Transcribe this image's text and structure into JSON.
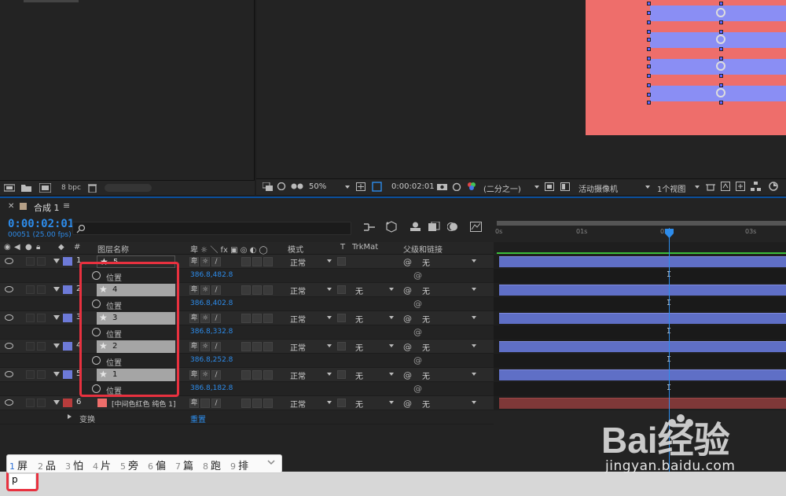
{
  "viewer_toolbar": {
    "bpc_label": "8 bpc",
    "zoom": "50%",
    "timecode": "0:00:02:01",
    "resolution": "(二分之一)",
    "camera": "活动摄像机",
    "views": "1个视图"
  },
  "timeline": {
    "tab_title": "合成 1",
    "current_time": "0:00:02:01",
    "frame_info": "00051 (25.00 fps)",
    "search_placeholder": "",
    "headers": {
      "number": "#",
      "layer_name": "图层名称",
      "mode": "模式",
      "t": "T",
      "trkmat": "TrkMat",
      "parent": "父级和链接"
    },
    "ruler_ticks": [
      "0s",
      "01s",
      "02s",
      "03s"
    ],
    "layers": [
      {
        "num": "1",
        "name": "5",
        "mode": "正常",
        "trkmat": "",
        "parent": "无",
        "prop_label": "位置",
        "prop_value": "386.8,482.8"
      },
      {
        "num": "2",
        "name": "4",
        "mode": "正常",
        "trkmat": "无",
        "parent": "无",
        "prop_label": "位置",
        "prop_value": "386.8,402.8"
      },
      {
        "num": "3",
        "name": "3",
        "mode": "正常",
        "trkmat": "无",
        "parent": "无",
        "prop_label": "位置",
        "prop_value": "386.8,332.8"
      },
      {
        "num": "4",
        "name": "2",
        "mode": "正常",
        "trkmat": "无",
        "parent": "无",
        "prop_label": "位置",
        "prop_value": "386.8,252.8"
      },
      {
        "num": "5",
        "name": "1",
        "mode": "正常",
        "trkmat": "无",
        "parent": "无",
        "prop_label": "位置",
        "prop_value": "386.8,182.8"
      }
    ],
    "solid_layer": {
      "num": "6",
      "name": "[中间色红色 纯色 1]",
      "mode": "正常",
      "trkmat": "无",
      "parent": "无"
    },
    "transform": {
      "label": "变换",
      "reset": "重置"
    }
  },
  "ime": {
    "candidates": [
      {
        "num": "1",
        "char": "屏"
      },
      {
        "num": "2",
        "char": "品"
      },
      {
        "num": "3",
        "char": "怕"
      },
      {
        "num": "4",
        "char": "片"
      },
      {
        "num": "5",
        "char": "旁"
      },
      {
        "num": "6",
        "char": "偏"
      },
      {
        "num": "7",
        "char": "篇"
      },
      {
        "num": "8",
        "char": "跑"
      },
      {
        "num": "9",
        "char": "排"
      }
    ],
    "input_text": "p"
  },
  "watermark": {
    "brand": "Bai经验",
    "url": "jingyan.baidu.com"
  },
  "colors": {
    "accent_blue": "#2d8ceb",
    "layer_bar": "#5f6fc6",
    "solid_bar": "#7f3838",
    "canvas_red": "#ee6e6b",
    "stripe_blue": "#8a8ef4",
    "highlight_red": "#e8313f"
  }
}
